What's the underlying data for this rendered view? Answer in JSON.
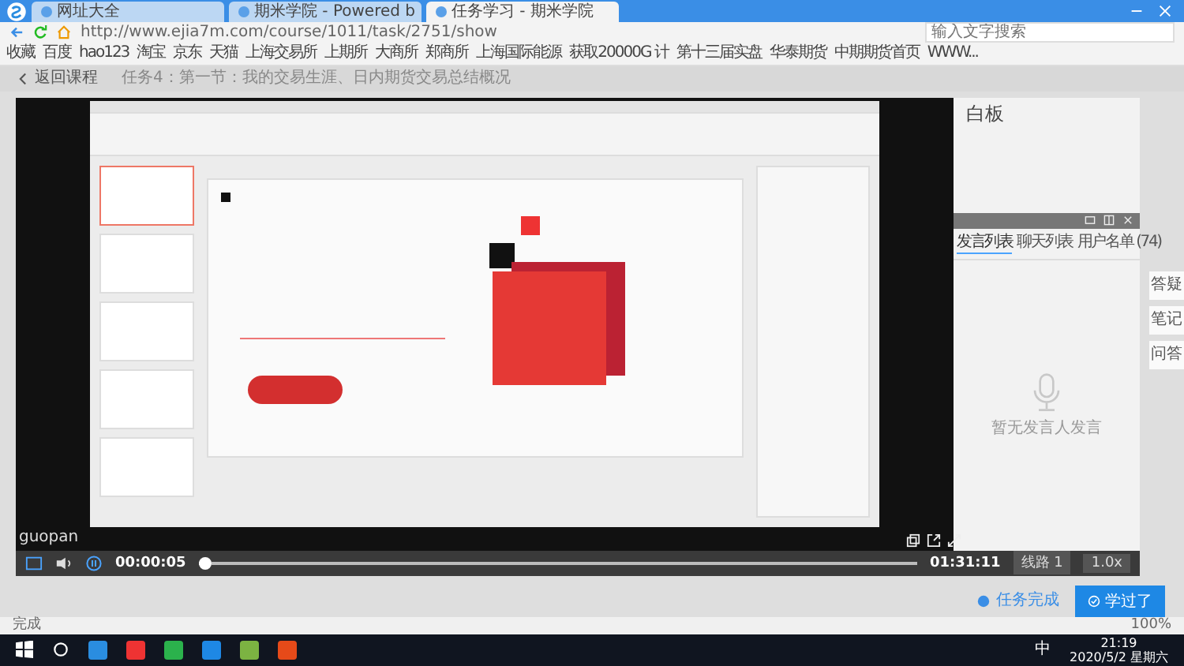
{
  "browser": {
    "tabs": [
      {
        "title": "网址大全",
        "selected": false
      },
      {
        "title": "期米学院 - Powered b",
        "selected": false
      },
      {
        "title": "任务学习 - 期米学院",
        "selected": true
      }
    ],
    "url": "http://www.ejia7m.com/course/1011/task/2751/show",
    "search": {
      "placeholder": "输入文字搜索"
    },
    "bookmarks": [
      "收藏",
      "百度",
      "hao123",
      "淘宝",
      "京东",
      "天猫",
      "上海交易所",
      "上期所",
      "大商所",
      "郑商所",
      "上海国际能源",
      "获取20000G 计",
      "第十三届实盘",
      "华泰期货",
      "中期期货首页",
      "WWW..."
    ]
  },
  "page": {
    "back": "返回课程",
    "task_title": "任务4：第一节：我的交易生涯、日内期货交易总结概况"
  },
  "player": {
    "username": "guopan",
    "current": "00:00:05",
    "duration": "01:31:11",
    "level": 0.001,
    "line": "线路 1",
    "speed": "1.0x"
  },
  "panel": {
    "title": "白板",
    "tabs": [
      {
        "label": "发言列表",
        "selected": true
      },
      {
        "label": "聊天列表",
        "selected": false
      },
      {
        "label": "用户名单",
        "count": "(74)",
        "selected": false
      }
    ],
    "empty": "暂无发言人发言"
  },
  "side_tools": [
    "答疑",
    "笔记",
    "问答"
  ],
  "actions": {
    "done": "任务完成",
    "learned": "学过了"
  },
  "status_bar": {
    "left": "完成",
    "zoom": "100%"
  },
  "taskbar": {
    "ime": "中",
    "time": "21:19",
    "date": "2020/5/2 星期六"
  }
}
